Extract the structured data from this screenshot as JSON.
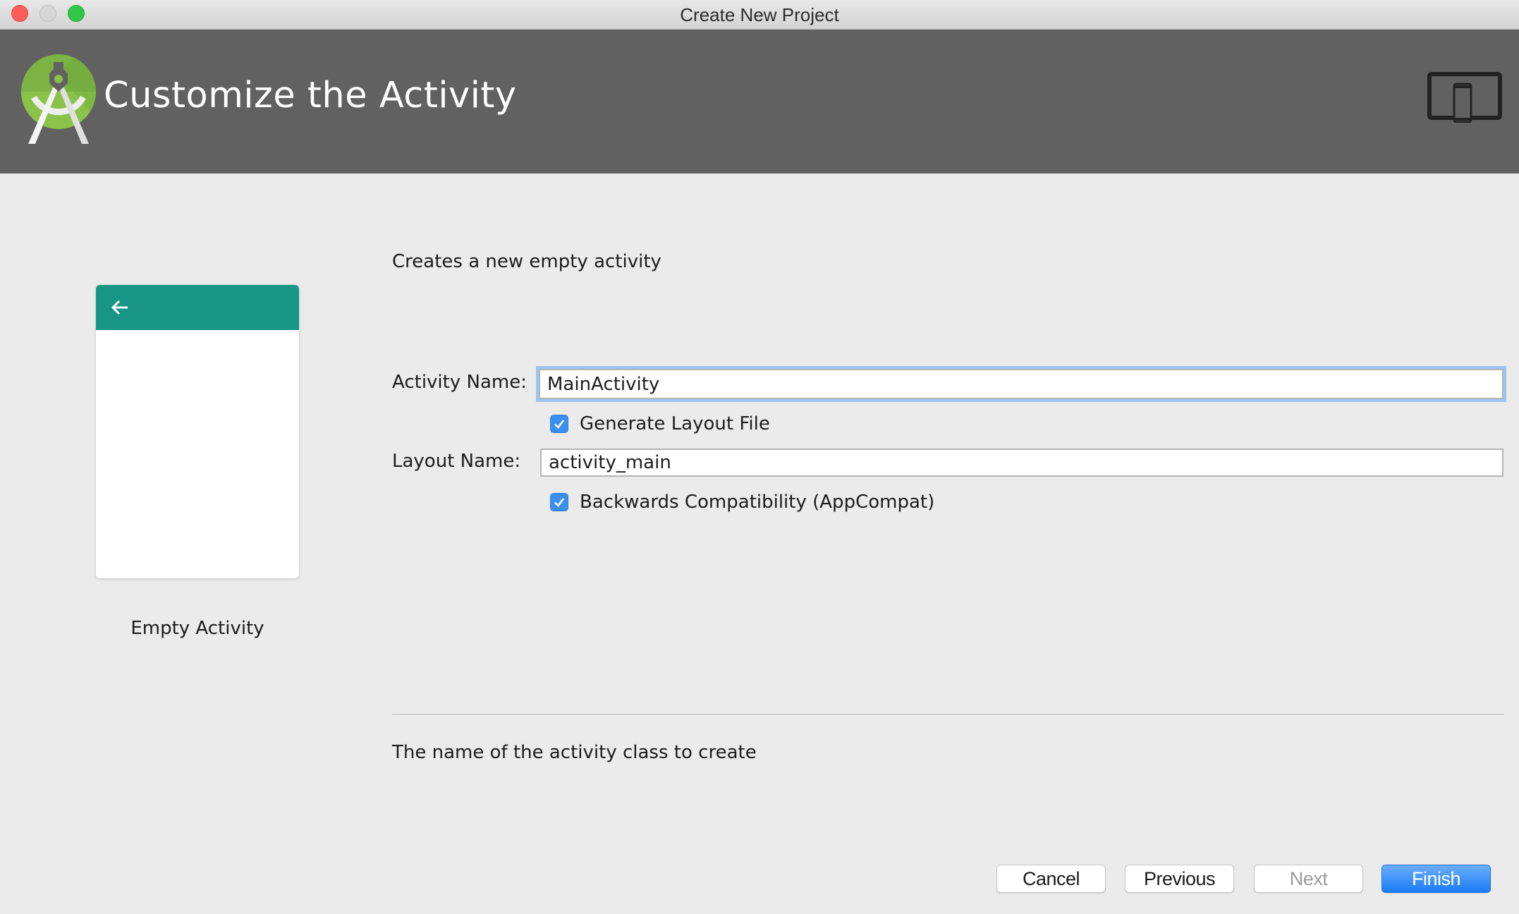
{
  "window": {
    "title": "Create New Project",
    "controls": [
      "close",
      "minimize",
      "maximize"
    ]
  },
  "header": {
    "title": "Customize the Activity",
    "logo_icon": "android-studio-logo",
    "form_factor_icon": "tablet-phone-icon"
  },
  "preview": {
    "template_name": "Empty Activity",
    "appbar_icon": "back-arrow-icon",
    "appbar_color": "#179585"
  },
  "form": {
    "description": "Creates a new empty activity",
    "activity_name": {
      "label": "Activity Name:",
      "value": "MainActivity",
      "focused": true
    },
    "generate_layout": {
      "label": "Generate Layout File",
      "checked": true
    },
    "layout_name": {
      "label": "Layout Name:",
      "value": "activity_main"
    },
    "backwards_compat": {
      "label": "Backwards Compatibility (AppCompat)",
      "checked": true
    },
    "hint": "The name of the activity class to create"
  },
  "buttons": {
    "cancel": "Cancel",
    "previous": "Previous",
    "next": "Next",
    "next_enabled": false,
    "finish": "Finish"
  },
  "colors": {
    "header_bg": "#616161",
    "body_bg": "#ebebeb",
    "accent_blue": "#1b7bf6",
    "checkbox_blue": "#3b8ff0",
    "focus_ring": "#9cc5f4"
  }
}
